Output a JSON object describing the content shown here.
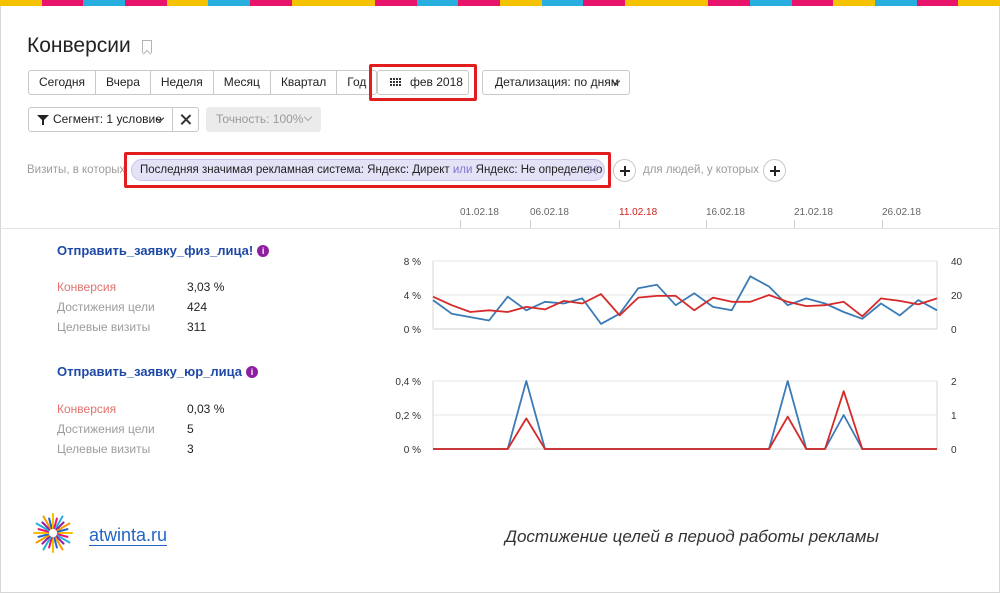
{
  "colors": {
    "stripe": [
      "#f5c200",
      "#e8146c",
      "#29aee0",
      "#e8146c",
      "#f5c200",
      "#29aee0",
      "#e8146c",
      "#f5c200"
    ],
    "highlight": "#e11d1d",
    "goal_link": "#1f49a6",
    "series_conversion": "#d62a2a",
    "series_visits": "#3a7bb5"
  },
  "header": {
    "title": "Конверсии"
  },
  "period": {
    "buttons": [
      "Сегодня",
      "Вчера",
      "Неделя",
      "Месяц",
      "Квартал",
      "Год"
    ],
    "month_label": "фев 2018",
    "detail_label": "Детализация: по дням"
  },
  "segment": {
    "label": "Сегмент: 1 условие",
    "accuracy_label": "Точность: 100%"
  },
  "filter": {
    "prefix": "Визиты, в которых",
    "condition_main": "Последняя значимая рекламная система: Яндекс: Директ",
    "condition_or": "или",
    "condition_tail": "Яндекс: Не определено",
    "people_label": "для людей, у которых"
  },
  "timeline": {
    "dates": [
      {
        "label": "01.02.18",
        "weekend": false
      },
      {
        "label": "06.02.18",
        "weekend": false
      },
      {
        "label": "11.02.18",
        "weekend": true
      },
      {
        "label": "16.02.18",
        "weekend": false
      },
      {
        "label": "21.02.18",
        "weekend": false
      },
      {
        "label": "26.02.18",
        "weekend": false
      }
    ]
  },
  "goals": [
    {
      "title": "Отправить_заявку_физ_лица!",
      "info": "i",
      "metrics": [
        {
          "label": "Конверсия",
          "value": "3,03 %"
        },
        {
          "label": "Достижения цели",
          "value": "424"
        },
        {
          "label": "Целевые визиты",
          "value": "311"
        }
      ]
    },
    {
      "title": "Отправить_заявку_юр_лица",
      "info": "i",
      "metrics": [
        {
          "label": "Конверсия",
          "value": "0,03 %"
        },
        {
          "label": "Достижения цели",
          "value": "5"
        },
        {
          "label": "Целевые визиты",
          "value": "3"
        }
      ]
    }
  ],
  "chart_data": [
    {
      "type": "line",
      "x": [
        1,
        2,
        3,
        4,
        5,
        6,
        7,
        8,
        9,
        10,
        11,
        12,
        13,
        14,
        15,
        16,
        17,
        18,
        19,
        20,
        21,
        22,
        23,
        24,
        25,
        26,
        27,
        28
      ],
      "left_ticks": [
        "8 %",
        "4 %",
        "0 %"
      ],
      "right_ticks": [
        "40",
        "20",
        "0"
      ],
      "left_ylim": [
        0,
        8
      ],
      "right_ylim": [
        0,
        40
      ],
      "series": [
        {
          "axis": "left",
          "color": "#d62a2a",
          "values": [
            3.8,
            2.8,
            2.0,
            2.2,
            2.0,
            2.6,
            2.3,
            3.3,
            3.0,
            4.1,
            1.6,
            3.7,
            3.9,
            3.9,
            2.2,
            3.7,
            3.2,
            3.2,
            4.0,
            3.2,
            2.7,
            2.8,
            3.2,
            1.5,
            3.6,
            3.3,
            2.9,
            3.6
          ]
        },
        {
          "axis": "right",
          "color": "#3a7bb5",
          "values": [
            17,
            9,
            7,
            5,
            19,
            11,
            16,
            15,
            18,
            3,
            9,
            24,
            26,
            14,
            21,
            13,
            11,
            31,
            25,
            14,
            18,
            15,
            10,
            6,
            15,
            8,
            17,
            11
          ]
        }
      ]
    },
    {
      "type": "line",
      "x": [
        1,
        2,
        3,
        4,
        5,
        6,
        7,
        8,
        9,
        10,
        11,
        12,
        13,
        14,
        15,
        16,
        17,
        18,
        19,
        20,
        21,
        22,
        23,
        24,
        25,
        26,
        27,
        28
      ],
      "left_ticks": [
        "0,4 %",
        "0,2 %",
        "0 %"
      ],
      "right_ticks": [
        "2",
        "1",
        "0"
      ],
      "left_ylim": [
        0,
        0.4
      ],
      "right_ylim": [
        0,
        2
      ],
      "series": [
        {
          "axis": "left",
          "color": "#d62a2a",
          "values": [
            0,
            0,
            0,
            0,
            0,
            0.18,
            0,
            0,
            0,
            0,
            0,
            0,
            0,
            0,
            0,
            0,
            0,
            0,
            0,
            0.19,
            0,
            0,
            0.34,
            0,
            0,
            0,
            0,
            0
          ]
        },
        {
          "axis": "right",
          "color": "#3a7bb5",
          "values": [
            0,
            0,
            0,
            0,
            0,
            2,
            0,
            0,
            0,
            0,
            0,
            0,
            0,
            0,
            0,
            0,
            0,
            0,
            0,
            2,
            0,
            0,
            1,
            0,
            0,
            0,
            0,
            0
          ]
        }
      ]
    }
  ],
  "footer": {
    "logo_text": "atwinta.ru",
    "caption": "Достижение целей в период работы рекламы"
  }
}
